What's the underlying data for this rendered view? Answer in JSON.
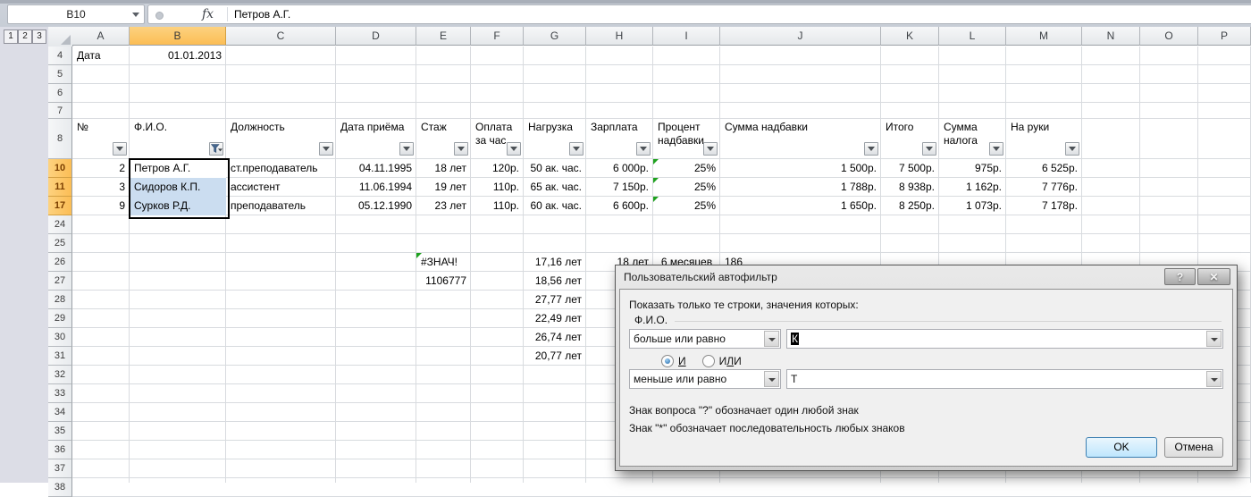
{
  "formula_bar": {
    "name_box": "B10",
    "fx_label": "fx",
    "formula": "Петров А.Г."
  },
  "outline": {
    "buttons": [
      "1",
      "2",
      "3"
    ]
  },
  "sheet": {
    "col_letters": [
      "A",
      "B",
      "C",
      "D",
      "E",
      "F",
      "G",
      "H",
      "I",
      "J",
      "K",
      "L",
      "M",
      "N",
      "O",
      "P"
    ],
    "row_numbers": [
      "4",
      "5",
      "6",
      "7",
      "8",
      "10",
      "11",
      "17",
      "24",
      "25",
      "26",
      "27",
      "28",
      "29",
      "30",
      "31",
      "32",
      "33",
      "34",
      "35",
      "36",
      "37",
      "38"
    ],
    "selected_col": "B",
    "selected_rows": [
      "10",
      "11",
      "17"
    ],
    "selection": {
      "active_cell": "B10",
      "range_cols": "B",
      "range_rows": [
        "10",
        "11",
        "17"
      ]
    },
    "filter": {
      "cols": [
        "A",
        "B",
        "C",
        "D",
        "E",
        "F",
        "G",
        "H",
        "I",
        "J",
        "K",
        "L",
        "M"
      ],
      "funnel_col": "B"
    },
    "cells": [
      {
        "r": "4",
        "c": "A",
        "t": "Дата",
        "a": "l"
      },
      {
        "r": "4",
        "c": "B",
        "t": "01.01.2013",
        "a": "r"
      },
      {
        "r": "8",
        "c": "A",
        "t": "№",
        "a": "l",
        "hdr": true
      },
      {
        "r": "8",
        "c": "B",
        "t": "Ф.И.О.",
        "a": "l",
        "hdr": true
      },
      {
        "r": "8",
        "c": "C",
        "t": "Должность",
        "a": "l",
        "hdr": true
      },
      {
        "r": "8",
        "c": "D",
        "t": "Дата приёма",
        "a": "l",
        "hdr": true
      },
      {
        "r": "8",
        "c": "E",
        "t": "Стаж",
        "a": "l",
        "hdr": true
      },
      {
        "r": "8",
        "c": "F",
        "t": "Оплата за час",
        "a": "l",
        "hdr": true
      },
      {
        "r": "8",
        "c": "G",
        "t": "Нагрузка",
        "a": "l",
        "hdr": true
      },
      {
        "r": "8",
        "c": "H",
        "t": "Зарплата",
        "a": "l",
        "hdr": true
      },
      {
        "r": "8",
        "c": "I",
        "t": "Процент надбавки",
        "a": "l",
        "hdr": true
      },
      {
        "r": "8",
        "c": "J",
        "t": "Сумма надбавки",
        "a": "l",
        "hdr": true
      },
      {
        "r": "8",
        "c": "K",
        "t": "Итого",
        "a": "l",
        "hdr": true
      },
      {
        "r": "8",
        "c": "L",
        "t": "Сумма налога",
        "a": "l",
        "hdr": true
      },
      {
        "r": "8",
        "c": "M",
        "t": "На руки",
        "a": "l",
        "hdr": true
      },
      {
        "r": "10",
        "c": "A",
        "t": "2",
        "a": "r"
      },
      {
        "r": "10",
        "c": "B",
        "t": "Петров А.Г.",
        "a": "l",
        "sel": "active"
      },
      {
        "r": "10",
        "c": "C",
        "t": "ст.преподаватель",
        "a": "l"
      },
      {
        "r": "10",
        "c": "D",
        "t": "04.11.1995",
        "a": "r"
      },
      {
        "r": "10",
        "c": "E",
        "t": "18 лет",
        "a": "r"
      },
      {
        "r": "10",
        "c": "F",
        "t": "120р.",
        "a": "r"
      },
      {
        "r": "10",
        "c": "G",
        "t": "50 ак. час.",
        "a": "r"
      },
      {
        "r": "10",
        "c": "H",
        "t": "6 000р.",
        "a": "r"
      },
      {
        "r": "10",
        "c": "I",
        "t": "25%",
        "a": "r",
        "tri": true
      },
      {
        "r": "10",
        "c": "J",
        "t": "1 500р.",
        "a": "r"
      },
      {
        "r": "10",
        "c": "K",
        "t": "7 500р.",
        "a": "r"
      },
      {
        "r": "10",
        "c": "L",
        "t": "975р.",
        "a": "r"
      },
      {
        "r": "10",
        "c": "M",
        "t": "6 525р.",
        "a": "r"
      },
      {
        "r": "11",
        "c": "A",
        "t": "3",
        "a": "r"
      },
      {
        "r": "11",
        "c": "B",
        "t": "Сидоров К.П.",
        "a": "l",
        "sel": "range"
      },
      {
        "r": "11",
        "c": "C",
        "t": "ассистент",
        "a": "l"
      },
      {
        "r": "11",
        "c": "D",
        "t": "11.06.1994",
        "a": "r"
      },
      {
        "r": "11",
        "c": "E",
        "t": "19 лет",
        "a": "r"
      },
      {
        "r": "11",
        "c": "F",
        "t": "110р.",
        "a": "r"
      },
      {
        "r": "11",
        "c": "G",
        "t": "65 ак. час.",
        "a": "r"
      },
      {
        "r": "11",
        "c": "H",
        "t": "7 150р.",
        "a": "r"
      },
      {
        "r": "11",
        "c": "I",
        "t": "25%",
        "a": "r",
        "tri": true
      },
      {
        "r": "11",
        "c": "J",
        "t": "1 788р.",
        "a": "r"
      },
      {
        "r": "11",
        "c": "K",
        "t": "8 938р.",
        "a": "r"
      },
      {
        "r": "11",
        "c": "L",
        "t": "1 162р.",
        "a": "r"
      },
      {
        "r": "11",
        "c": "M",
        "t": "7 776р.",
        "a": "r"
      },
      {
        "r": "17",
        "c": "A",
        "t": "9",
        "a": "r"
      },
      {
        "r": "17",
        "c": "B",
        "t": "Сурков Р.Д.",
        "a": "l",
        "sel": "range"
      },
      {
        "r": "17",
        "c": "C",
        "t": "преподаватель",
        "a": "l"
      },
      {
        "r": "17",
        "c": "D",
        "t": "05.12.1990",
        "a": "r"
      },
      {
        "r": "17",
        "c": "E",
        "t": "23 лет",
        "a": "r"
      },
      {
        "r": "17",
        "c": "F",
        "t": "110р.",
        "a": "r"
      },
      {
        "r": "17",
        "c": "G",
        "t": "60 ак. час.",
        "a": "r"
      },
      {
        "r": "17",
        "c": "H",
        "t": "6 600р.",
        "a": "r"
      },
      {
        "r": "17",
        "c": "I",
        "t": "25%",
        "a": "r",
        "tri": true
      },
      {
        "r": "17",
        "c": "J",
        "t": "1 650р.",
        "a": "r"
      },
      {
        "r": "17",
        "c": "K",
        "t": "8 250р.",
        "a": "r"
      },
      {
        "r": "17",
        "c": "L",
        "t": "1 073р.",
        "a": "r"
      },
      {
        "r": "17",
        "c": "M",
        "t": "7 178р.",
        "a": "r"
      },
      {
        "r": "26",
        "c": "E",
        "t": "#ЗНАЧ!",
        "a": "l",
        "tri": true
      },
      {
        "r": "26",
        "c": "G",
        "t": "17,16 лет",
        "a": "r"
      },
      {
        "r": "26",
        "c": "H",
        "t": "18 лет",
        "a": "r"
      },
      {
        "r": "26",
        "c": "I",
        "t": "6 месяцев",
        "a": "c"
      },
      {
        "r": "26",
        "c": "J",
        "t": "186",
        "a": "l"
      },
      {
        "r": "27",
        "c": "E",
        "t": "1106777",
        "a": "r"
      },
      {
        "r": "27",
        "c": "G",
        "t": "18,56 лет",
        "a": "r"
      },
      {
        "r": "28",
        "c": "G",
        "t": "27,77 лет",
        "a": "r"
      },
      {
        "r": "29",
        "c": "G",
        "t": "22,49 лет",
        "a": "r"
      },
      {
        "r": "30",
        "c": "G",
        "t": "26,74 лет",
        "a": "r"
      },
      {
        "r": "31",
        "c": "G",
        "t": "20,77 лет",
        "a": "r"
      }
    ]
  },
  "dialog": {
    "title": "Пользовательский автофильтр",
    "help_label": "?",
    "close_label": "✕",
    "prompt": "Показать только те строки, значения которых:",
    "field_label": "Ф.И.О.",
    "condition1": {
      "operator": "больше или равно",
      "value": "К"
    },
    "logic": {
      "and_label": "И",
      "or_pre": "И",
      "or_key": "Л",
      "or_post": "И",
      "selected": "И"
    },
    "condition2": {
      "operator": "меньше или равно",
      "value": "Т"
    },
    "hint1": "Знак вопроса \"?\" обозначает один любой знак",
    "hint2": "Знак \"*\" обозначает последовательность любых знаков",
    "ok_label": "OK",
    "cancel_label": "Отмена"
  }
}
